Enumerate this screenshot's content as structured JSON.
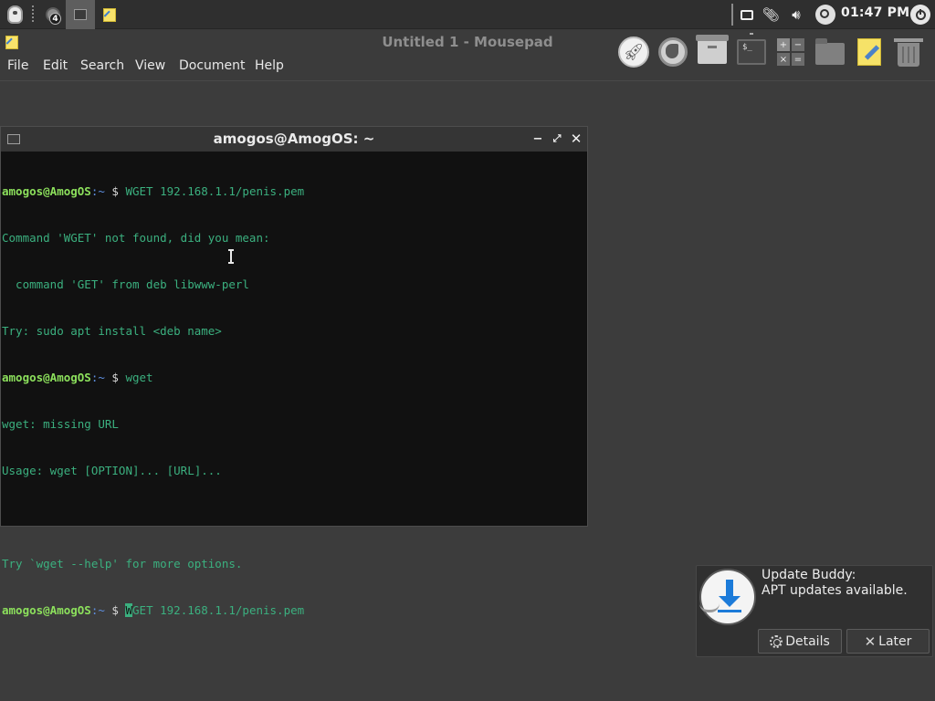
{
  "top_panel": {
    "workspace_count": "4",
    "clock": "01:47 PM"
  },
  "mousepad": {
    "title": "Untitled 1 - Mousepad",
    "menus": [
      "File",
      "Edit",
      "Search",
      "View",
      "Document",
      "Help"
    ]
  },
  "terminal": {
    "title": "amogos@AmogOS: ~",
    "prompt_user": "amogos@AmogOS",
    "prompt_path": ":~",
    "prompt_dollar": " $ ",
    "cmd1": "WGET 192.168.1.1/penis.pem",
    "out1": "Command 'WGET' not found, did you mean:",
    "out2": "  command 'GET' from deb libwww-perl",
    "out3": "Try: sudo apt install <deb name>",
    "cmd2": "wget",
    "out4": "wget: missing URL",
    "out5": "Usage: wget [OPTION]... [URL]...",
    "out6": "",
    "out7": "Try `wget --help' for more options.",
    "cmd3_first": "W",
    "cmd3_rest": "GET 192.168.1.1/penis.pem",
    "controls": {
      "minimize": "−",
      "maximize": "⤢",
      "close": "✕"
    }
  },
  "notification": {
    "title": "Update Buddy:",
    "body": "APT updates available.",
    "details_label": "Details",
    "later_label": "Later"
  },
  "colors": {
    "terminal_bg": "#111111",
    "terminal_text": "#3bb07f",
    "prompt_user": "#8ce05c",
    "prompt_path": "#5e8fe0",
    "download_arrow": "#1c7bd9"
  },
  "icons": {
    "dock": [
      "rocket-icon",
      "browser-icon",
      "archive-icon",
      "terminal-icon",
      "calculator-icon",
      "files-icon",
      "text-editor-icon",
      "trash-icon"
    ],
    "tray": [
      "notification-icon",
      "attachment-icon",
      "volume-icon",
      "search-icon",
      "power-icon"
    ]
  }
}
